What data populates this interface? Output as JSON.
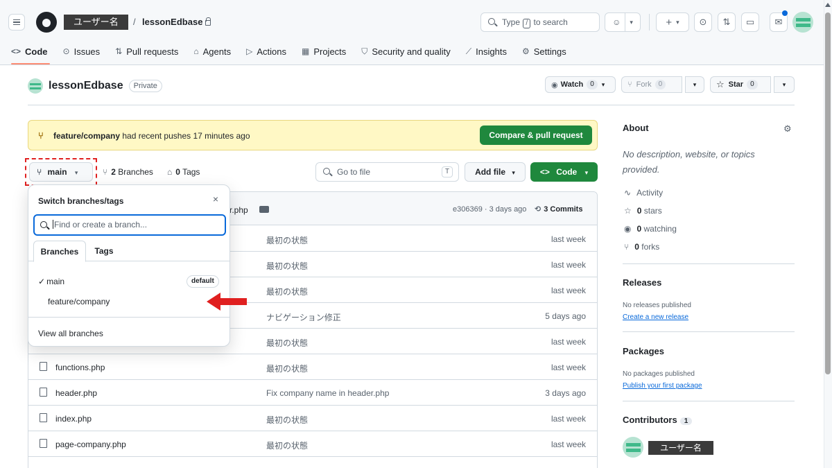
{
  "header": {
    "owner": "ユーザー名",
    "slash": "/",
    "repo": "lessonEdbase",
    "search_prefix": "Type",
    "search_key": "/",
    "search_suffix": "to search",
    "plus": "+",
    "caret": "▾"
  },
  "tabs": [
    {
      "label": "Code",
      "icon": "<>"
    },
    {
      "label": "Issues",
      "icon": "⊙"
    },
    {
      "label": "Pull requests",
      "icon": "⇅"
    },
    {
      "label": "Agents",
      "icon": "⌂"
    },
    {
      "label": "Actions",
      "icon": "▷"
    },
    {
      "label": "Projects",
      "icon": "▦"
    },
    {
      "label": "Security and quality",
      "icon": "⛉"
    },
    {
      "label": "Insights",
      "icon": "⟋"
    },
    {
      "label": "Settings",
      "icon": "⚙"
    }
  ],
  "repo": {
    "name": "lessonEdbase",
    "visibility": "Private",
    "watch_label": "Watch",
    "watch_count": "0",
    "fork_label": "Fork",
    "fork_count": "0",
    "star_label": "Star",
    "star_count": "0"
  },
  "banner": {
    "branch": "feature/company",
    "text": "had recent pushes 17 minutes ago",
    "button": "Compare & pull request"
  },
  "filenav": {
    "branch": "main",
    "branches_count": "2",
    "branches_label": "Branches",
    "tags_count": "0",
    "tags_label": "Tags",
    "goto_placeholder": "Go to file",
    "goto_key": "T",
    "add_file": "Add file",
    "code": "Code"
  },
  "commit_header": {
    "partial_name": "r.php",
    "sha_time": "e306369 · 3 days ago",
    "commits": "3 Commits"
  },
  "files": [
    {
      "name": "",
      "message": "最初の状態",
      "date": "last week"
    },
    {
      "name": "",
      "message": "最初の状態",
      "date": "last week"
    },
    {
      "name": "",
      "message": "最初の状態",
      "date": "last week"
    },
    {
      "name": "",
      "message": "ナビゲーション修正",
      "date": "5 days ago"
    },
    {
      "name": "",
      "message": "最初の状態",
      "date": "last week"
    },
    {
      "name": "functions.php",
      "message": "最初の状態",
      "date": "last week"
    },
    {
      "name": "header.php",
      "message": "Fix company name in header.php",
      "date": "3 days ago"
    },
    {
      "name": "index.php",
      "message": "最初の状態",
      "date": "last week"
    },
    {
      "name": "page-company.php",
      "message": "最初の状態",
      "date": "last week"
    }
  ],
  "dropdown": {
    "title": "Switch branches/tags",
    "close": "×",
    "placeholder": "Find or create a branch...",
    "tab_branches": "Branches",
    "tab_tags": "Tags",
    "branch_main": "main",
    "default_badge": "default",
    "branch_feature": "feature/company",
    "view_all": "View all branches"
  },
  "sidebar": {
    "about_title": "About",
    "description": "No description, website, or topics provided.",
    "activity": "Activity",
    "stars": "0",
    "stars_label": "stars",
    "watching": "0",
    "watching_label": "watching",
    "forks": "0",
    "forks_label": "forks",
    "releases_title": "Releases",
    "releases_empty": "No releases published",
    "releases_link": "Create a new release",
    "packages_title": "Packages",
    "packages_empty": "No packages published",
    "packages_link": "Publish your first package",
    "contributors_title": "Contributors",
    "contributors_count": "1",
    "contributor_name": "ユーザー名"
  },
  "colors": {
    "accent_green": "#1f883d",
    "link_blue": "#0969da",
    "annotation_red": "#e02020",
    "banner_bg": "#fff8c5"
  }
}
